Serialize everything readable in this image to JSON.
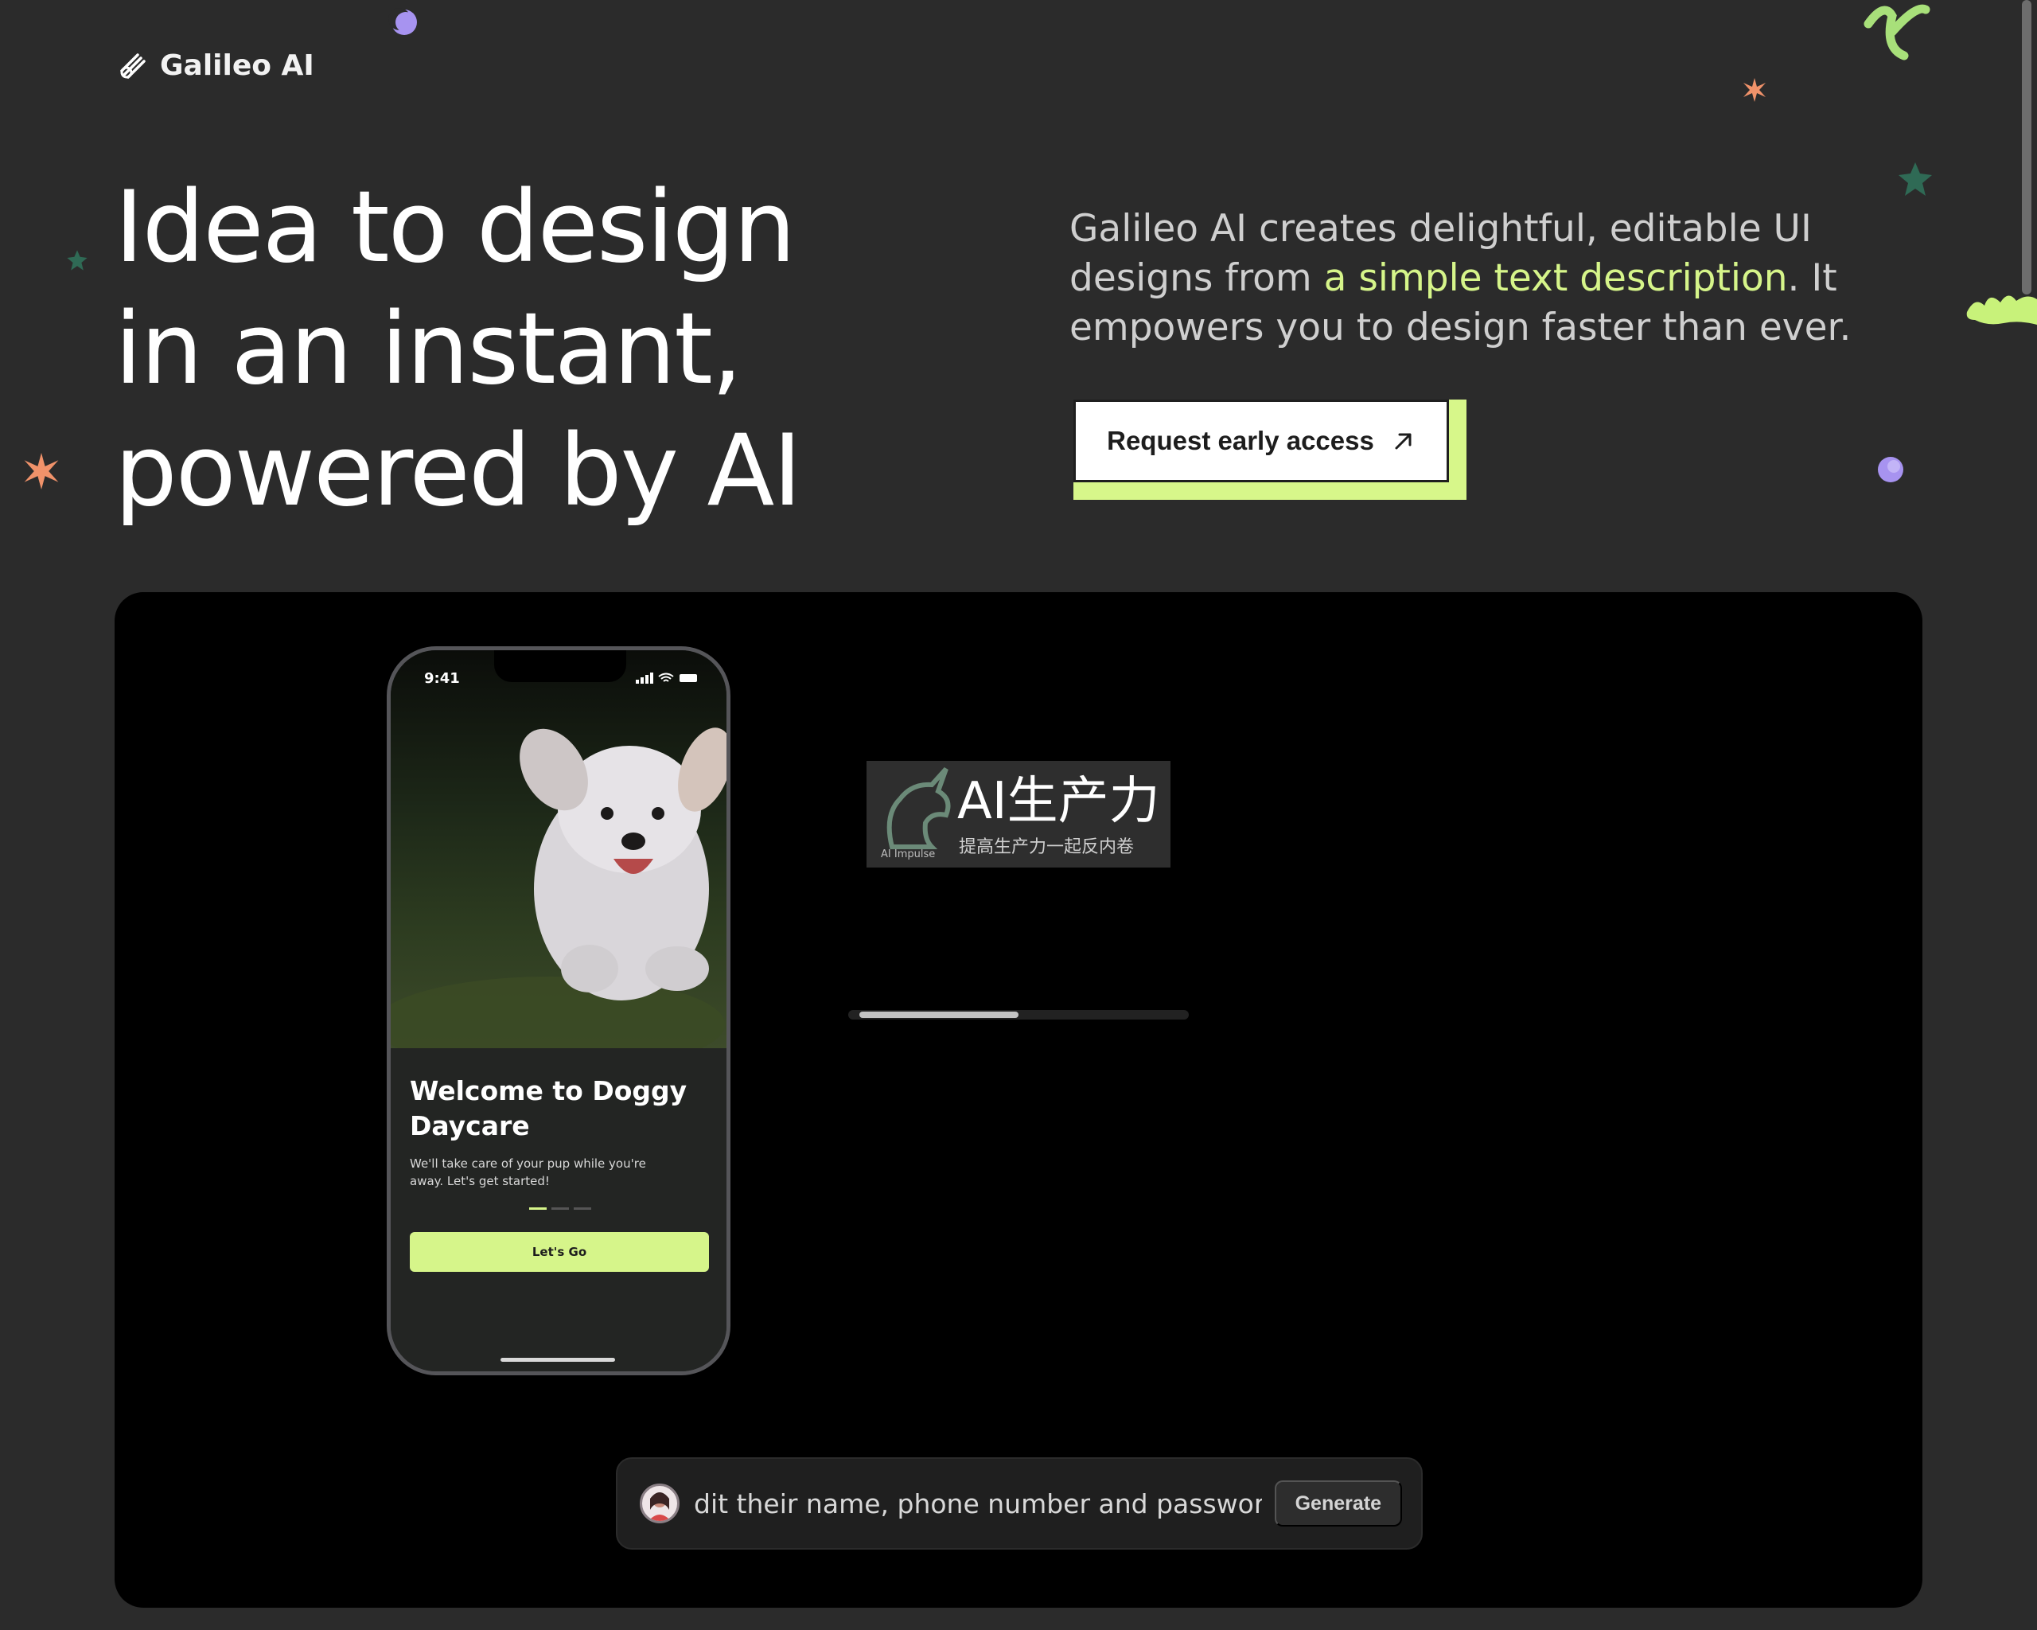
{
  "brand": {
    "name": "Galileo AI",
    "icon": "galileo-logo-icon"
  },
  "hero": {
    "headline": [
      "Idea to design",
      "in an instant,",
      "powered by AI"
    ],
    "description_before": "Galileo AI creates delightful, editable UI designs from ",
    "description_accent": "a simple text description",
    "description_after": ". It empowers you to design faster than ever.",
    "cta_label": "Request early access",
    "cta_icon": "arrow-up-right-icon"
  },
  "demo": {
    "phone": {
      "time": "9:41",
      "title": "Welcome to Doggy Daycare",
      "subtitle": "We'll take care of your pup while you're away. Let's get started!",
      "button_label": "Let's Go",
      "pagination_active": 1,
      "pagination_total": 3
    },
    "watermark": {
      "brand": "AI生产力",
      "tagline": "提高生产力一起反内卷",
      "logo_text": "AI Impulse"
    },
    "progress": 0.5,
    "prompt": {
      "text": "dit their name, phone number and password",
      "generate_label": "Generate"
    }
  },
  "colors": {
    "background": "#2b2b2b",
    "accent": "#d6f58a",
    "purple": "#a793f0",
    "orange": "#f0926a",
    "teal": "#2f6a55"
  }
}
